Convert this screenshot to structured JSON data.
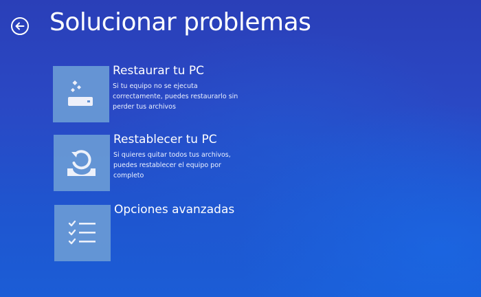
{
  "header": {
    "back_icon": "back-arrow-circle-icon",
    "title": "Solucionar problemas"
  },
  "options": [
    {
      "title": "Restaurar tu PC",
      "description": "Si tu equipo no se ejecuta correctamente, puedes restaurarlo sin perder tus archivos",
      "icon": "restore-pc-icon"
    },
    {
      "title": "Restablecer tu PC",
      "description": "Si quieres quitar todos tus archivos, puedes restablecer el equipo por completo",
      "icon": "reset-pc-icon"
    },
    {
      "title": "Opciones avanzadas",
      "description": "",
      "icon": "checklist-icon"
    }
  ],
  "colors": {
    "background": "#2a48c4",
    "tile": "#6a9bd6",
    "text": "#ffffff"
  }
}
